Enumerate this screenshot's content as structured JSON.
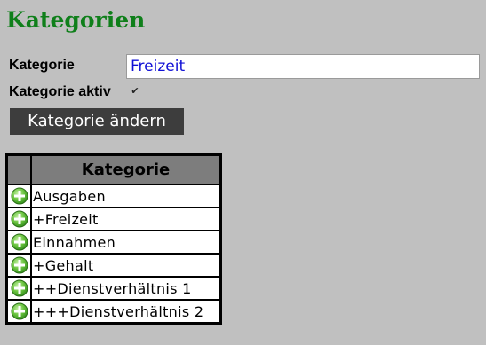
{
  "page": {
    "title": "Kategorien"
  },
  "form": {
    "kategorie_label": "Kategorie",
    "kategorie_value": "Freizeit",
    "aktiv_label": "Kategorie aktiv",
    "aktiv_checked": true,
    "submit_label": "Kategorie ändern"
  },
  "table": {
    "header": "Kategorie",
    "rows": [
      {
        "icon": "add-icon",
        "label": "Ausgaben"
      },
      {
        "icon": "add-icon",
        "label": "+Freizeit"
      },
      {
        "icon": "add-icon",
        "label": "Einnahmen"
      },
      {
        "icon": "add-icon",
        "label": "+Gehalt"
      },
      {
        "icon": "add-icon",
        "label": "++Dienstverhältnis 1"
      },
      {
        "icon": "add-icon",
        "label": "+++Dienstverhältnis 2"
      }
    ]
  },
  "colors": {
    "background": "#c0c0c0",
    "title": "#0f7f1a",
    "input_text": "#1111d6",
    "button": "#3d3d3d",
    "table_header": "#7d7d7d",
    "add_icon": "#5cb83a"
  }
}
